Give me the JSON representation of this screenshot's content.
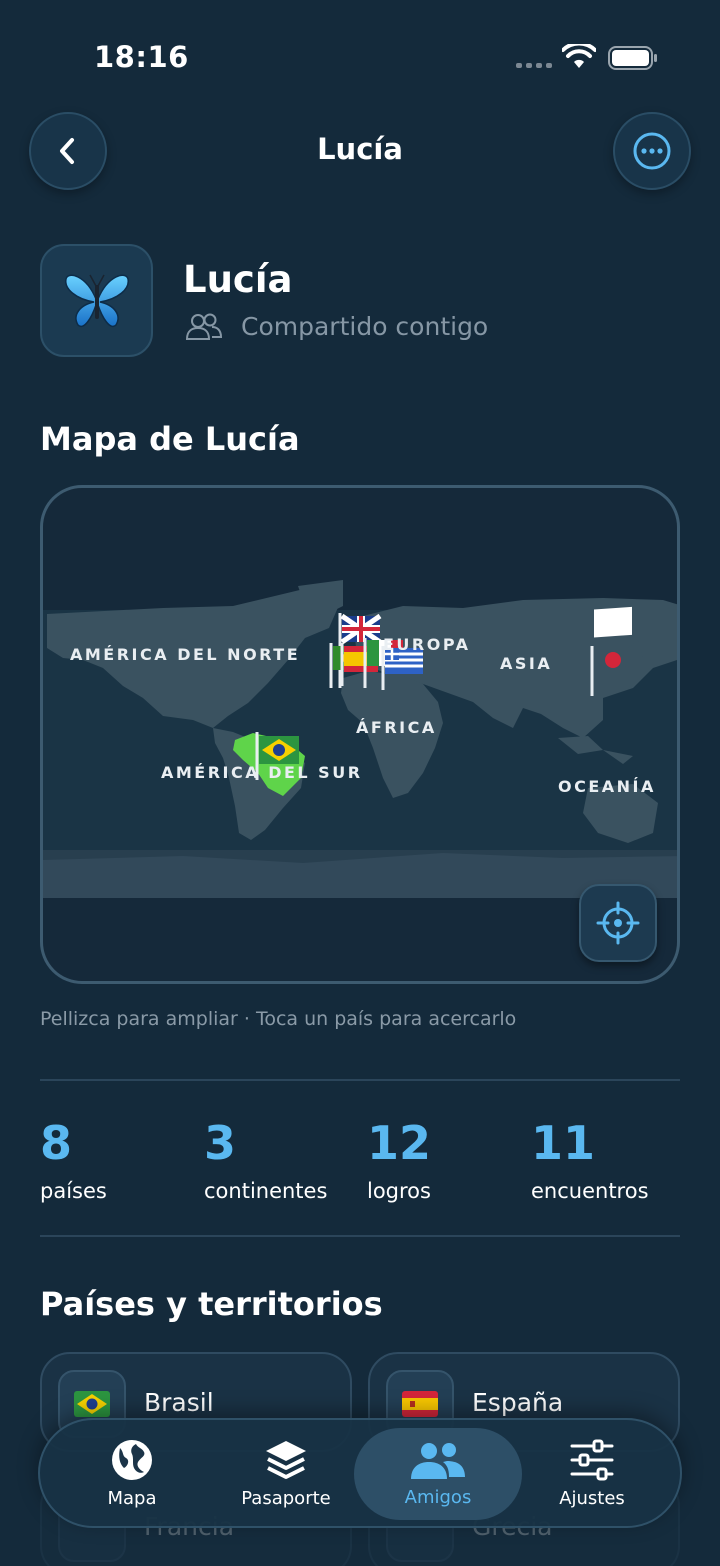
{
  "status_bar": {
    "time": "18:16"
  },
  "nav": {
    "title": "Lucía",
    "back_icon": "chevron-left-icon",
    "more_icon": "ellipsis-circle-icon"
  },
  "profile": {
    "name": "Lucía",
    "avatar_icon": "butterfly-icon",
    "shared_label": "Compartido contigo",
    "shared_icon": "people-icon"
  },
  "map_section": {
    "title": "Mapa de Lucía",
    "labels": {
      "north_america": "AMÉRICA DEL NORTE",
      "europe": "EUROPA",
      "asia": "ASIA",
      "africa": "ÁFRICA",
      "south_america": "AMÉRICA DEL SUR",
      "oceania": "OCEANÍA"
    },
    "hint": "Pellizca para ampliar · Toca un país para acercarlo",
    "locate_icon": "crosshair-icon",
    "highlight_color": "#5fd44a"
  },
  "stats": [
    {
      "value": "8",
      "label": "países"
    },
    {
      "value": "3",
      "label": "continentes"
    },
    {
      "value": "12",
      "label": "logros"
    },
    {
      "value": "11",
      "label": "encuentros"
    }
  ],
  "countries_section": {
    "title": "Países y territorios",
    "items": [
      {
        "name": "Brasil",
        "flag": "🇧🇷"
      },
      {
        "name": "España",
        "flag": "🇪🇸"
      },
      {
        "name": "Francia",
        "flag": "🇫🇷"
      },
      {
        "name": "Grecia",
        "flag": "🇬🇷"
      }
    ]
  },
  "tabbar": {
    "tabs": [
      {
        "label": "Mapa",
        "icon": "globe-icon"
      },
      {
        "label": "Pasaporte",
        "icon": "layers-icon"
      },
      {
        "label": "Amigos",
        "icon": "people-icon"
      },
      {
        "label": "Ajustes",
        "icon": "sliders-icon"
      }
    ],
    "active_color": "#5ab8f0"
  }
}
